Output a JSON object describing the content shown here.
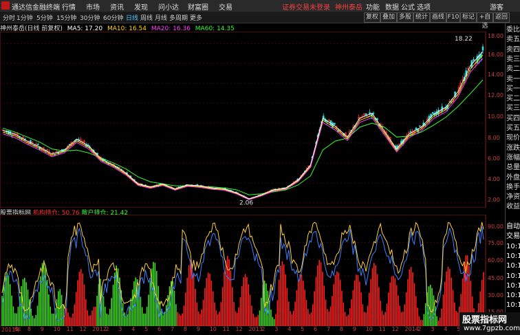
{
  "topbar": {
    "app_title": "通达信金融终端",
    "menus": [
      "行情",
      "市场",
      "资讯",
      "发现",
      "问小达",
      "财富圈",
      "交易"
    ],
    "notice": "证券交易未登录",
    "stock": "神州泰岳",
    "right_menus": [
      "功能",
      "数据",
      "公式",
      "选项",
      "游客"
    ]
  },
  "toolbar": {
    "periods": [
      "分时",
      "1分钟",
      "5分钟",
      "15分钟",
      "30分钟",
      "60分钟",
      "日线",
      "周线",
      "月线",
      "多周期",
      "更多"
    ],
    "active_period": "日线",
    "buttons": [
      "复权",
      "叠加",
      "多股",
      "统计",
      "画线",
      "F10",
      "标记",
      "+自选",
      "返回"
    ]
  },
  "main_info": {
    "title": "神州泰岳(日线 前复权)",
    "ma5": "MA5: 17.20",
    "ma10": "MA10: 16.54",
    "ma20": "MA20: 16.36",
    "ma60": "MA60: 14.35",
    "high_label": "18.22",
    "low_label": "2.06",
    "y_ticks": [
      "18.00",
      "16.00",
      "14.00",
      "12.00",
      "10.00",
      "8.00",
      "6.00",
      "4.00",
      "2.00"
    ]
  },
  "indicator_info": {
    "name": "股票指标网",
    "inst": "机构持仓: 50.76",
    "retail": "散户持仓: 21.42",
    "y_ticks": [
      "90.00",
      "75.00",
      "60.00",
      "45.00",
      "30.00",
      "15.00"
    ]
  },
  "right_side": [
    "委比",
    "卖五",
    "卖四",
    "卖三",
    "卖二",
    "卖一",
    "买一",
    "买二",
    "买三",
    "买四",
    "买五",
    "现价",
    "涨跌",
    "涨幅",
    "总量",
    "外盘",
    "换手",
    "净资",
    "收益",
    "",
    "自动",
    "交易",
    "10:1",
    "10:1",
    "10:1",
    "10:1",
    "10:1",
    "10:1",
    "10:1",
    "10:1"
  ],
  "x_labels": [
    "2011年",
    "6",
    "8",
    "9",
    "10",
    "11",
    "12",
    "2012",
    "2",
    "3",
    "4",
    "5",
    "6",
    "7",
    "8",
    "9",
    "10",
    "11",
    "12",
    "2013",
    "2",
    "3",
    "4",
    "5",
    "6",
    "7",
    "8",
    "9",
    "10",
    "11",
    "12",
    "2014",
    "2",
    "3",
    "4",
    "5",
    "6"
  ],
  "watermark": {
    "line1": "股票指标网",
    "line2": "www.7gpzb.com"
  },
  "colors": {
    "up": "#ff3030",
    "down": "#30e0e0",
    "ma5": "#ffffff",
    "ma10": "#ffd700",
    "ma20": "#ff40ff",
    "ma60": "#30ff30",
    "inst_bar": "#ff2020",
    "retail_bar": "#40e020",
    "ind_line1": "#ffd040",
    "ind_line2": "#4080ff"
  },
  "chart_data": [
    {
      "type": "line",
      "title": "神州泰岳(日线 前复权)",
      "ylim": [
        1.5,
        19.2
      ],
      "x_count": 36,
      "series": [
        {
          "name": "MA5",
          "values": [
            9.3,
            8.9,
            8.2,
            7.6,
            6.9,
            7.3,
            8.4,
            7.7,
            6.4,
            5.8,
            5.0,
            3.9,
            3.6,
            3.9,
            3.4,
            3.8,
            3.7,
            3.5,
            3.4,
            3.0,
            2.4,
            2.8,
            3.3,
            3.5,
            4.3,
            5.8,
            10.5,
            9.7,
            8.6,
            10.5,
            11.0,
            9.2,
            7.4,
            8.9,
            9.6,
            10.9,
            11.6,
            13.2,
            15.8,
            17.2
          ]
        },
        {
          "name": "MA60",
          "values": [
            9.5,
            9.1,
            8.6,
            8.1,
            7.4,
            7.2,
            7.3,
            7.0,
            6.5,
            6.0,
            5.4,
            4.6,
            4.1,
            3.9,
            3.7,
            3.7,
            3.6,
            3.6,
            3.5,
            3.3,
            2.8,
            2.9,
            3.1,
            3.3,
            3.8,
            4.7,
            7.3,
            8.2,
            8.5,
            9.6,
            10.0,
            9.6,
            8.6,
            8.7,
            9.1,
            9.8,
            10.6,
            11.7,
            13.0,
            14.35
          ]
        }
      ]
    },
    {
      "type": "bar",
      "title": "股票指标网",
      "ylim": [
        0,
        100
      ],
      "series": [
        {
          "name": "机构持仓",
          "values": [
            0,
            0,
            0,
            0,
            0,
            0,
            0,
            0,
            30,
            45,
            55,
            40,
            0,
            0,
            0,
            0,
            0,
            0,
            0,
            0,
            0,
            0,
            50,
            60,
            55,
            50,
            45,
            60,
            65,
            55,
            45,
            40,
            0,
            0,
            60,
            55,
            50,
            45,
            55,
            60,
            65,
            50,
            45,
            40,
            55,
            60,
            55,
            50,
            45,
            60,
            55,
            40,
            0,
            0,
            50,
            55,
            60,
            65,
            55,
            50.76
          ]
        },
        {
          "name": "散户持仓",
          "values": [
            45,
            50,
            55,
            40,
            35,
            60,
            55,
            40,
            0,
            0,
            0,
            0,
            45,
            50,
            55,
            45,
            40,
            50,
            55,
            60,
            45,
            40,
            0,
            0,
            0,
            0,
            0,
            0,
            0,
            0,
            0,
            0,
            40,
            45,
            0,
            0,
            0,
            0,
            0,
            0,
            0,
            0,
            0,
            0,
            0,
            0,
            0,
            0,
            0,
            0,
            0,
            0,
            35,
            40,
            0,
            0,
            0,
            0,
            0,
            21.42
          ]
        }
      ]
    }
  ]
}
